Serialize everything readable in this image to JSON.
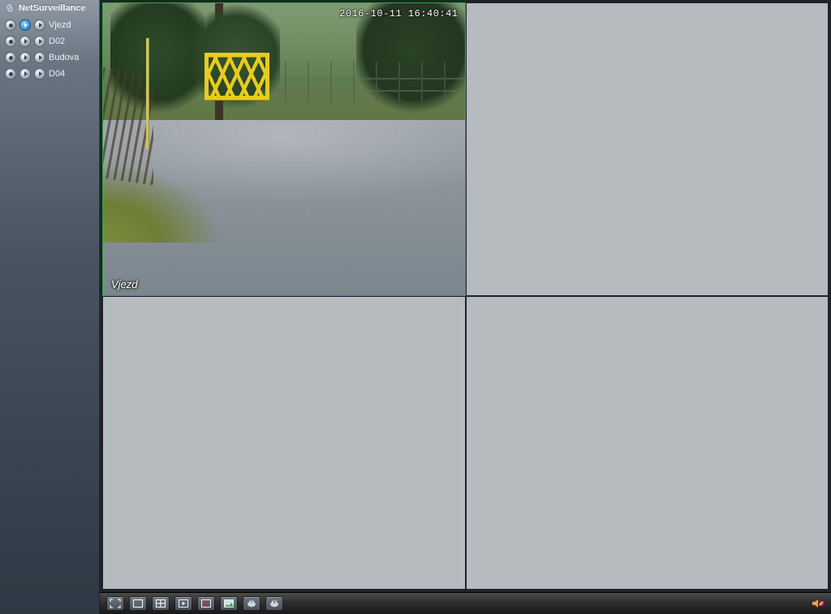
{
  "app": {
    "title": "NetSurveillance"
  },
  "sidebar": {
    "channels": [
      {
        "name": "Vjezd",
        "active": true
      },
      {
        "name": "D02",
        "active": false
      },
      {
        "name": "Budova",
        "active": false
      },
      {
        "name": "D04",
        "active": false
      }
    ]
  },
  "grid": {
    "cells": [
      {
        "camera": "Vjezd",
        "timestamp": "2016-10-11 16:40:41",
        "active": true
      },
      {
        "camera": null,
        "active": false
      },
      {
        "camera": null,
        "active": false
      },
      {
        "camera": null,
        "active": false
      }
    ]
  },
  "toolbar": {
    "buttons": [
      "fullscreen",
      "view-1",
      "view-4",
      "playback",
      "record-toggle",
      "snapshot",
      "ptz",
      "color-settings"
    ],
    "audio_muted": true
  }
}
